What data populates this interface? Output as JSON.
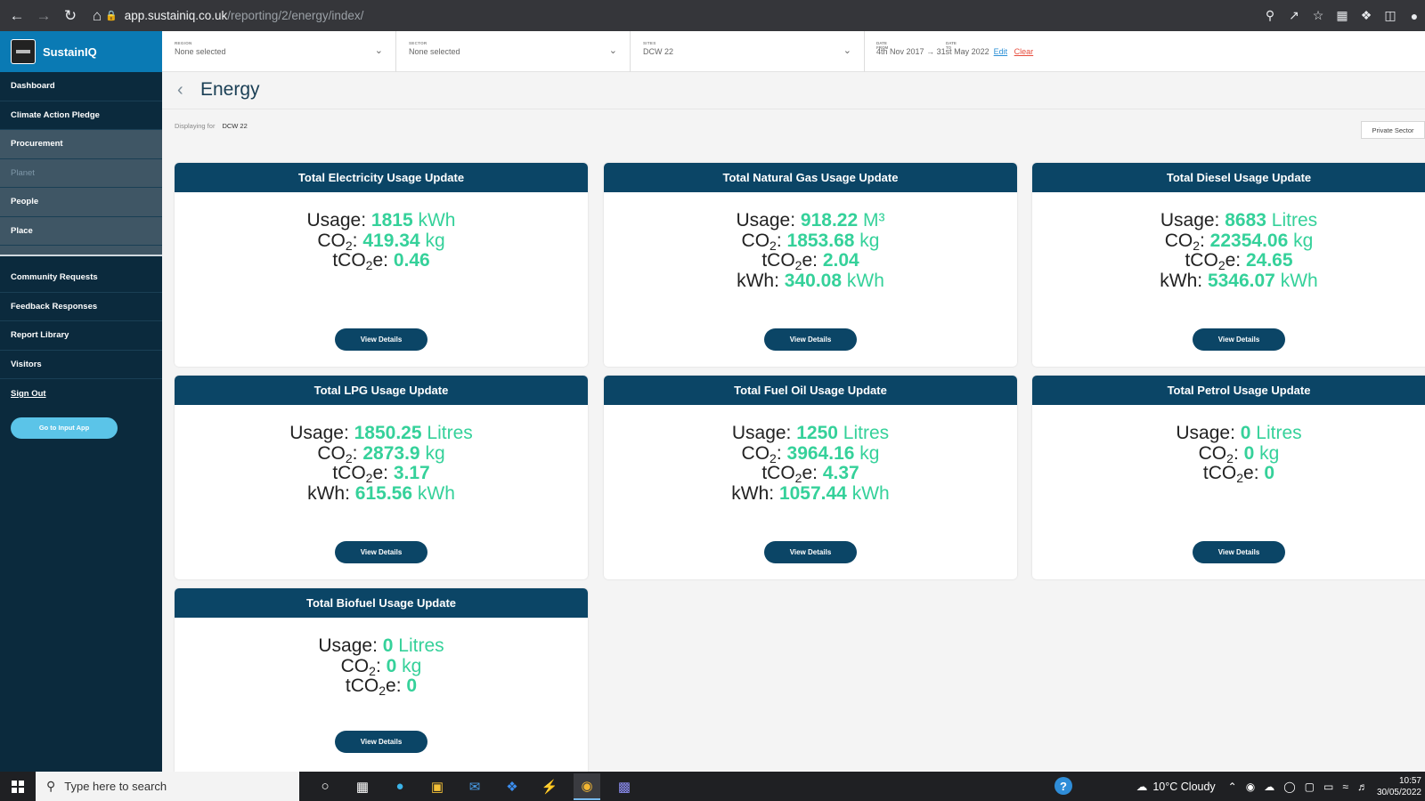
{
  "browser": {
    "url_host": "app.sustainiq.co.uk",
    "url_path": "/reporting/2/energy/index/"
  },
  "sidebar": {
    "brand": "SustainIQ",
    "items": [
      {
        "label": "Dashboard"
      },
      {
        "label": "Climate Action Pledge"
      },
      {
        "label": "Procurement"
      },
      {
        "label": "Planet"
      },
      {
        "label": "People"
      },
      {
        "label": "Place"
      },
      {
        "label": "Community Requests"
      },
      {
        "label": "Feedback Responses"
      },
      {
        "label": "Report Library"
      },
      {
        "label": "Visitors"
      },
      {
        "label": "Sign Out"
      }
    ],
    "cta": "Go to Input App"
  },
  "filters": {
    "region": {
      "caption": "REGION",
      "value": "None selected"
    },
    "sector": {
      "caption": "SECTOR",
      "value": "None selected"
    },
    "sites": {
      "caption": "SITES",
      "value": "DCW 22"
    },
    "date_from_caption": "DATE FROM",
    "date_to_caption": "DATE TO",
    "date_from": "4th Nov 2017",
    "date_to": "31st May 2022",
    "edit": "Edit",
    "clear": "Clear"
  },
  "page": {
    "title": "Energy",
    "displaying_label": "Displaying for",
    "displaying_value": "DCW 22",
    "sector_button": "Private Sector"
  },
  "cards": {
    "view_label": "View Details",
    "electricity": {
      "title": "Total Electricity Usage Update",
      "usage": "1815",
      "usage_unit": "kWh",
      "co2": "419.34",
      "tco2e": "0.46"
    },
    "gas": {
      "title": "Total Natural Gas Usage Update",
      "usage": "918.22",
      "usage_unit": "M³",
      "co2": "1853.68",
      "tco2e": "2.04",
      "kwh": "340.08"
    },
    "diesel": {
      "title": "Total Diesel Usage Update",
      "usage": "8683",
      "usage_unit": "Litres",
      "co2": "22354.06",
      "tco2e": "24.65",
      "kwh": "5346.07"
    },
    "lpg": {
      "title": "Total LPG Usage Update",
      "usage": "1850.25",
      "usage_unit": "Litres",
      "co2": "2873.9",
      "tco2e": "3.17",
      "kwh": "615.56"
    },
    "fueloil": {
      "title": "Total Fuel Oil Usage Update",
      "usage": "1250",
      "usage_unit": "Litres",
      "co2": "3964.16",
      "tco2e": "4.37",
      "kwh": "1057.44"
    },
    "petrol": {
      "title": "Total Petrol Usage Update",
      "usage": "0",
      "usage_unit": "Litres",
      "co2": "0",
      "tco2e": "0"
    },
    "biofuel": {
      "title": "Total Biofuel Usage Update",
      "usage": "0",
      "usage_unit": "Litres",
      "co2": "0",
      "tco2e": "0"
    }
  },
  "labels": {
    "usage": "Usage:",
    "co2_prefix": "CO",
    "co2_suffix": ":",
    "tco2e_prefix": "tCO",
    "tco2e_suffix": "e:",
    "sub2": "2",
    "kwh_label": "kWh:",
    "kg": "kg",
    "kwh_unit": "kWh"
  },
  "taskbar": {
    "search_placeholder": "Type here to search",
    "weather": "10°C  Cloudy",
    "time": "10:57",
    "date": "30/05/2022"
  },
  "colors": {
    "accent": "#35d19a",
    "card_header": "#0b4566",
    "sidebar": "#0b2a3d",
    "brand": "#0a7ab4"
  }
}
